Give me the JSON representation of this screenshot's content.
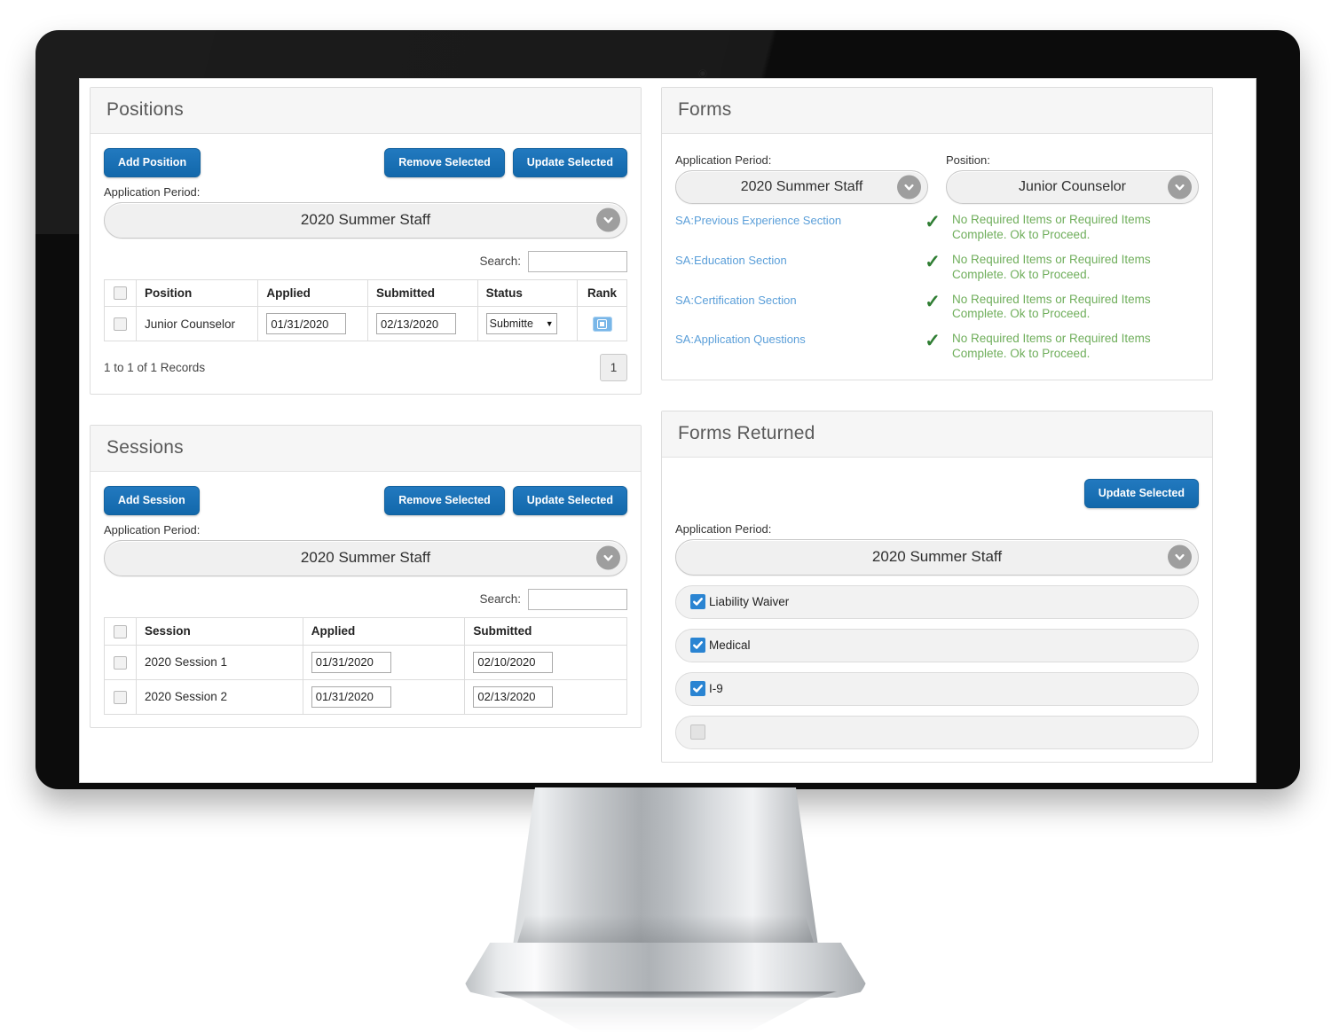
{
  "theme": {
    "button_blue": "#1268ab",
    "link_blue": "#5b9fd9",
    "success_green": "#6fae5b",
    "check_green": "#2e7d32",
    "checkbox_blue": "#2a84d2",
    "panel_header_bg": "#f6f6f6"
  },
  "positions_panel": {
    "title": "Positions",
    "add_button": "Add Position",
    "remove_button": "Remove Selected",
    "update_button": "Update Selected",
    "application_period_label": "Application Period:",
    "application_period_value": "2020 Summer Staff",
    "search_label": "Search:",
    "search_value": "",
    "search_placeholder": "",
    "columns": [
      "",
      "Position",
      "Applied",
      "Submitted",
      "Status",
      "Rank"
    ],
    "rows": [
      {
        "position": "Junior Counselor",
        "applied": "01/31/2020",
        "submitted": "02/13/2020",
        "status": "Submitte",
        "rank_icon": "id-card-icon"
      }
    ],
    "records_text": "1 to 1 of 1 Records",
    "page_number": "1"
  },
  "forms_panel": {
    "title": "Forms",
    "application_period_label": "Application Period:",
    "application_period_value": "2020 Summer Staff",
    "position_label": "Position:",
    "position_value": "Junior Counselor",
    "rows": [
      {
        "link": "SA:Previous Experience Section",
        "check": "check-icon",
        "status": "No Required Items or Required Items Complete. Ok to Proceed."
      },
      {
        "link": "SA:Education Section",
        "check": "check-icon",
        "status": "No Required Items or Required Items Complete. Ok to Proceed."
      },
      {
        "link": "SA:Certification Section",
        "check": "check-icon",
        "status": "No Required Items or Required Items Complete. Ok to Proceed."
      },
      {
        "link": "SA:Application Questions",
        "check": "check-icon",
        "status": "No Required Items or Required Items Complete. Ok to Proceed."
      }
    ]
  },
  "sessions_panel": {
    "title": "Sessions",
    "add_button": "Add Session",
    "remove_button": "Remove Selected",
    "update_button": "Update Selected",
    "application_period_label": "Application Period:",
    "application_period_value": "2020 Summer Staff",
    "search_label": "Search:",
    "search_value": "",
    "search_placeholder": "",
    "columns": [
      "",
      "Session",
      "Applied",
      "Submitted"
    ],
    "rows": [
      {
        "session": "2020 Session 1",
        "applied": "01/31/2020",
        "submitted": "02/10/2020"
      },
      {
        "session": "2020 Session 2",
        "applied": "01/31/2020",
        "submitted": "02/13/2020"
      }
    ]
  },
  "forms_returned_panel": {
    "title": "Forms Returned",
    "update_button": "Update Selected",
    "application_period_label": "Application Period:",
    "application_period_value": "2020 Summer Staff",
    "items": [
      {
        "label": "Liability Waiver",
        "checked": true
      },
      {
        "label": "Medical",
        "checked": true
      },
      {
        "label": "I-9",
        "checked": true
      },
      {
        "label": "",
        "checked": false
      }
    ]
  }
}
